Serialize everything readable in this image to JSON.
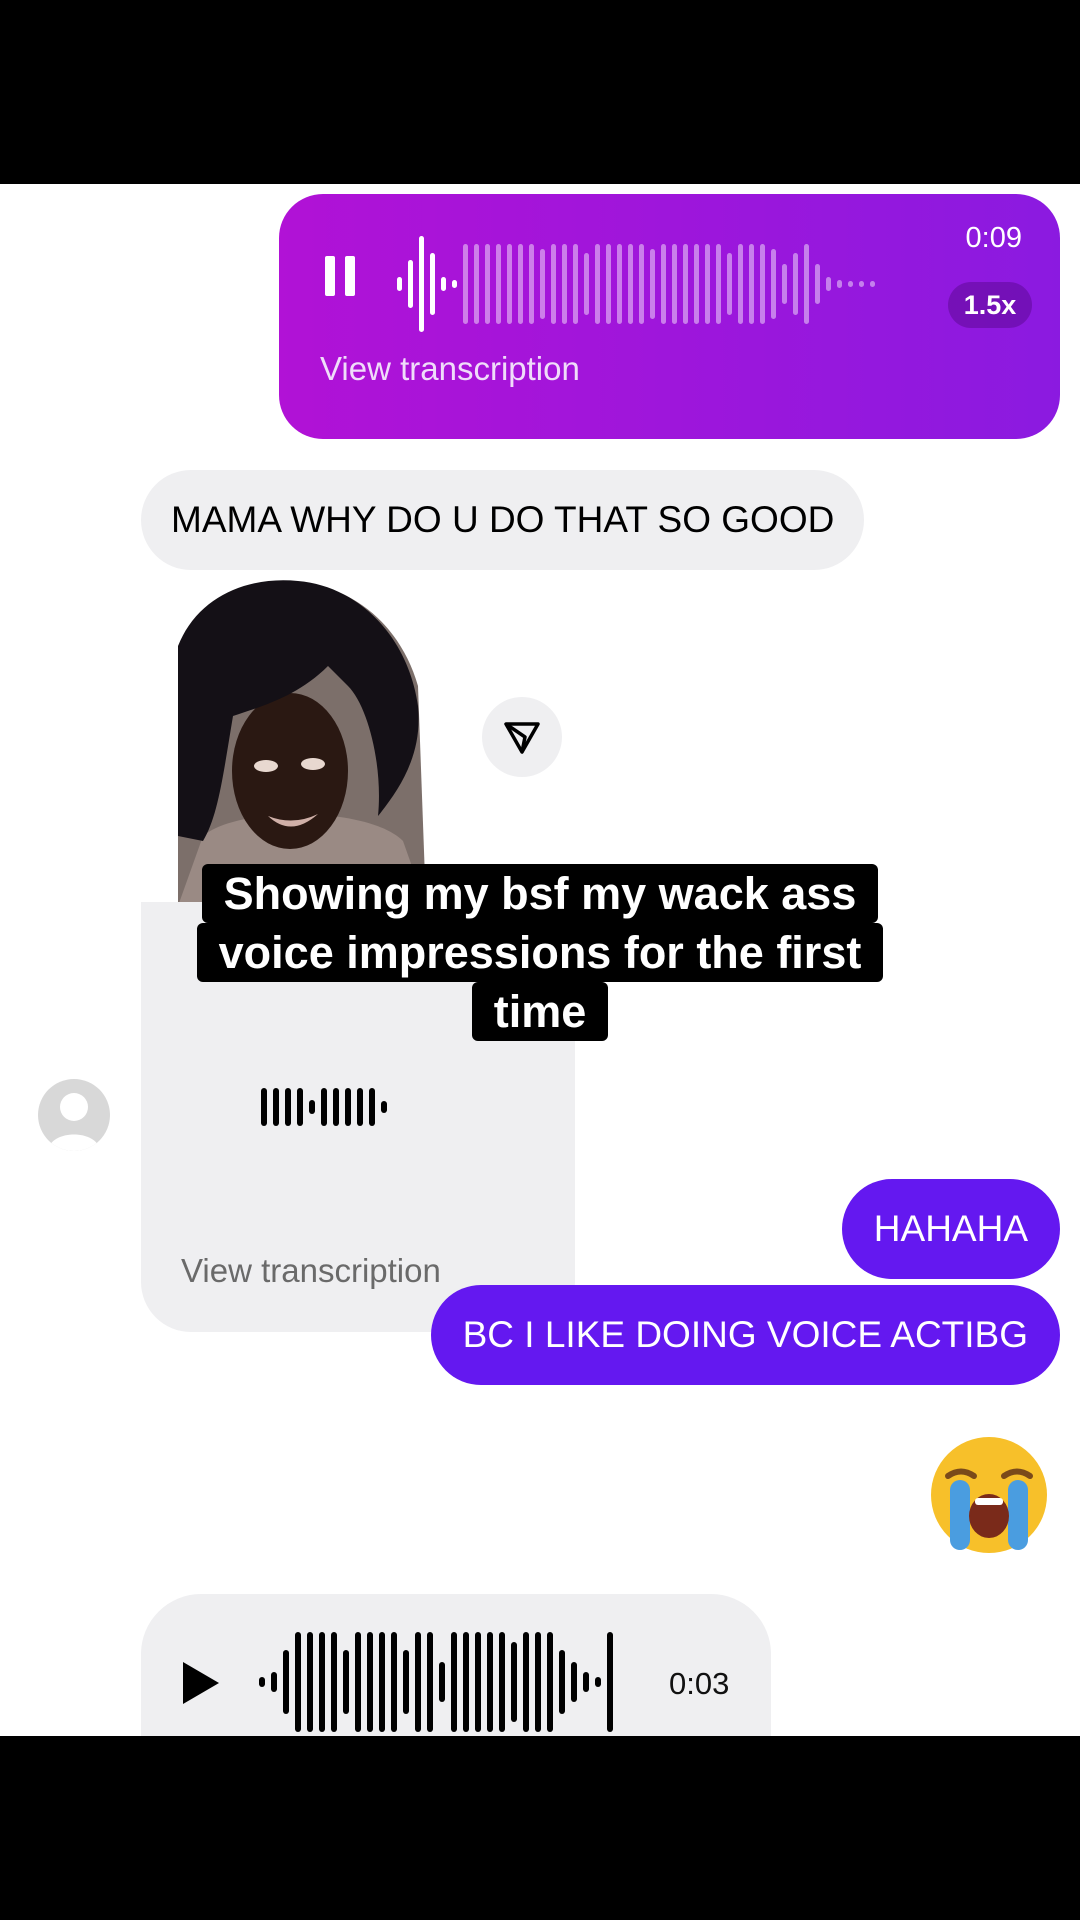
{
  "messages": {
    "voice_sent": {
      "duration": "0:09",
      "speed": "1.5x",
      "transcription_link": "View transcription"
    },
    "received_text": "MAMA WHY DO U DO THAT SO GOOD",
    "voice_received": {
      "transcription_link": "View transcription"
    },
    "sent_text_1": "HAHAHA",
    "sent_text_2": "BC I LIKE DOING VOICE ACTIBG",
    "sent_emoji": "loudly-crying-face",
    "voice_last": {
      "duration": "0:03"
    }
  },
  "caption": {
    "line1": "Showing my bsf my wack ass",
    "line2": "voice impressions for the first",
    "line3": "time"
  },
  "colors": {
    "voice_sent_start": "#b112d6",
    "voice_sent_end": "#8b1ae0",
    "sent_bubble": "#6418f0",
    "received_bubble": "#efeff1"
  }
}
